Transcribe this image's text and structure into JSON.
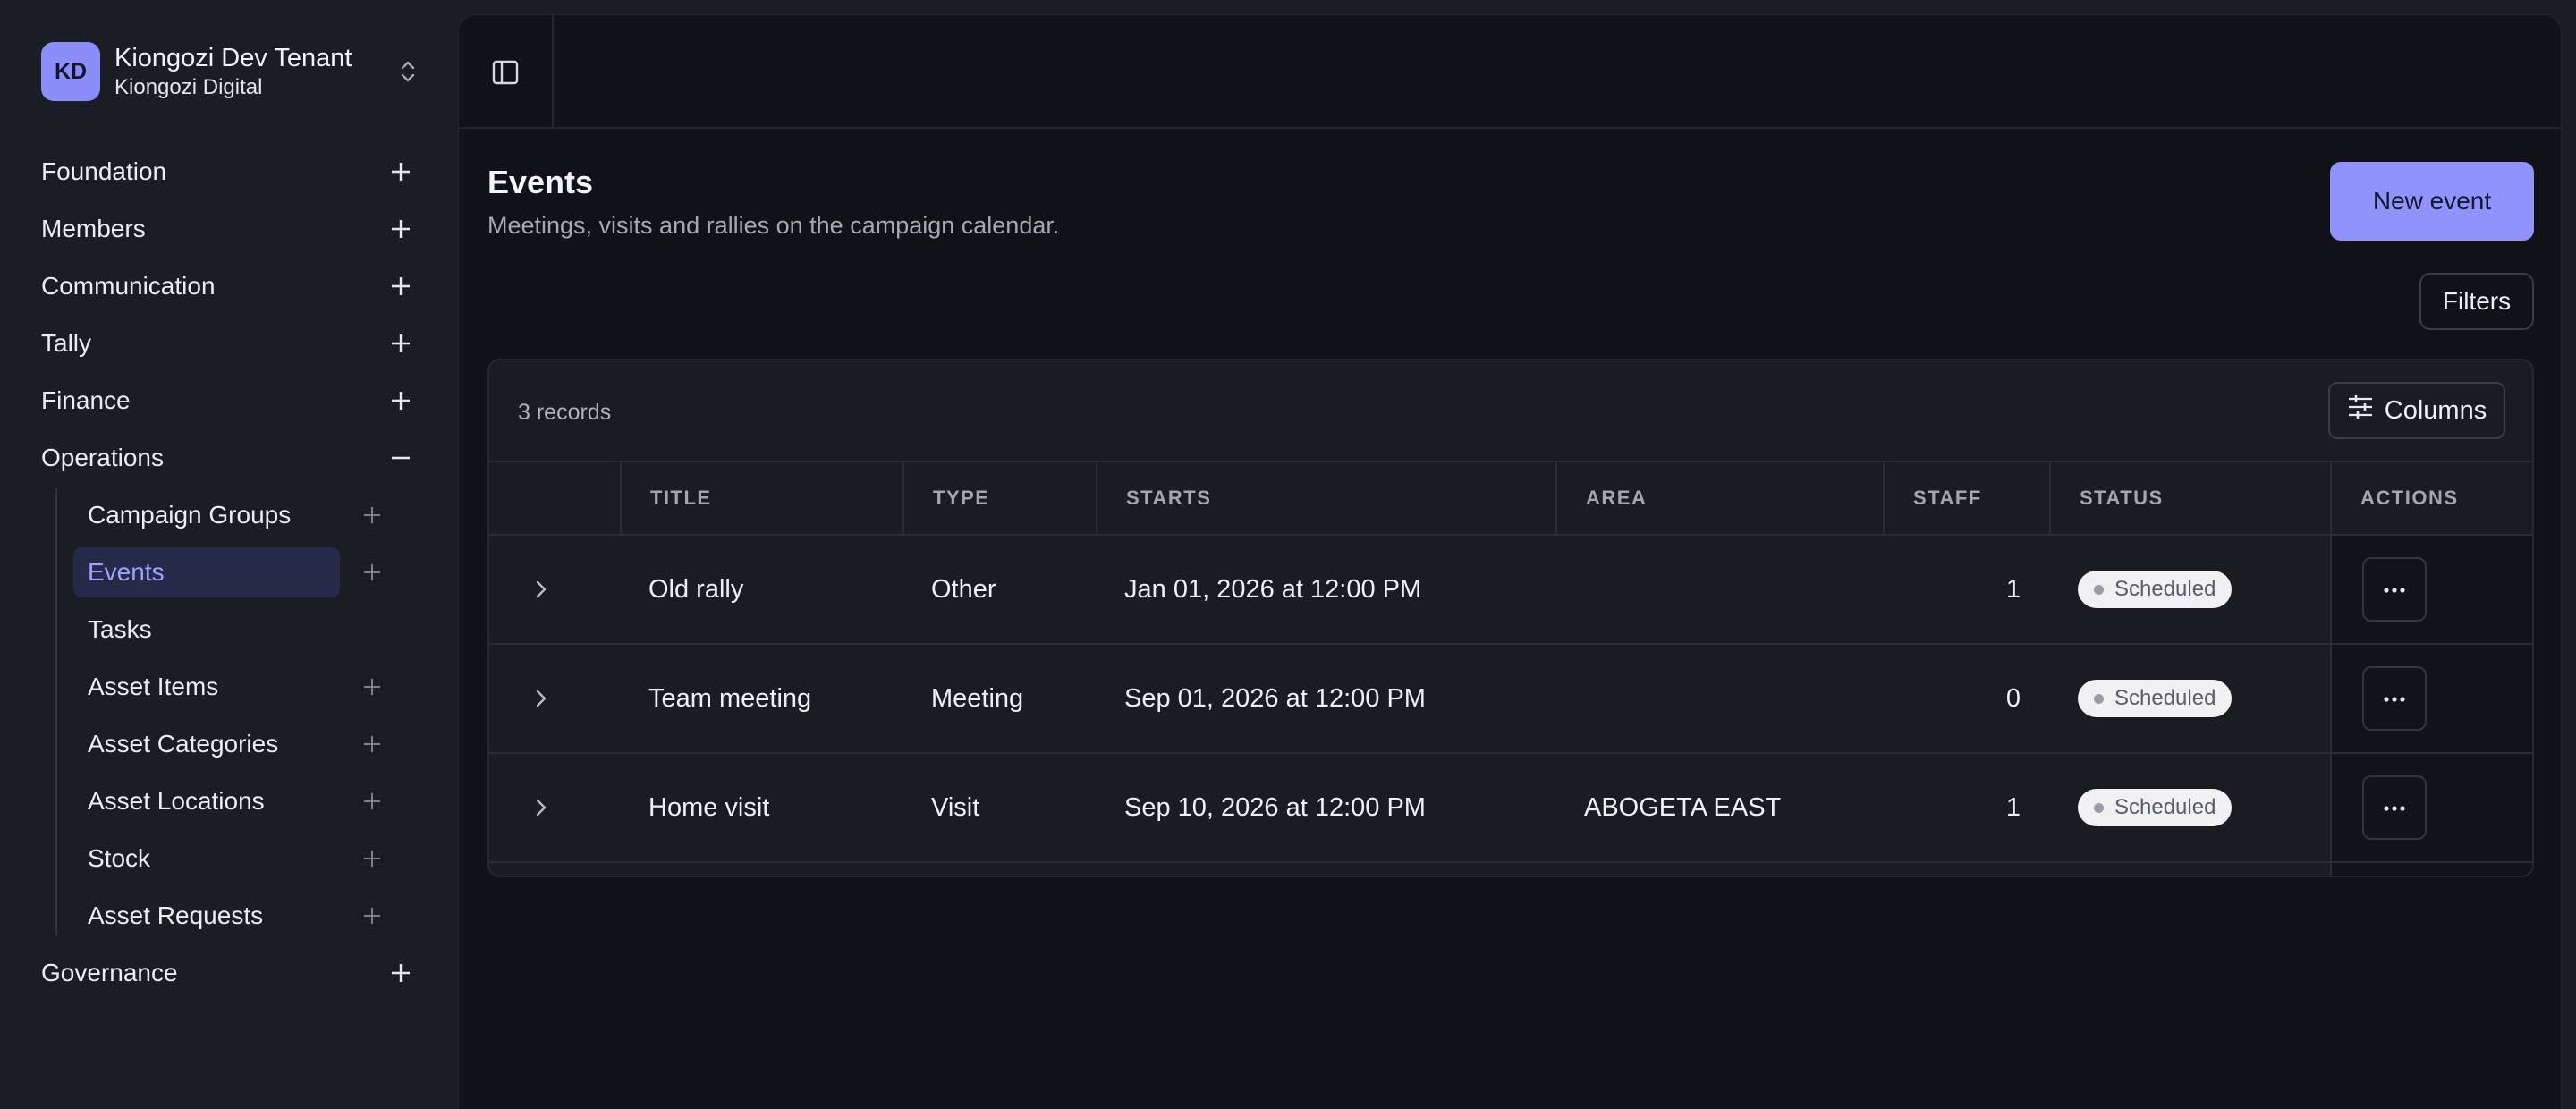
{
  "tenant": {
    "initials": "KD",
    "name": "Kiongozi Dev Tenant",
    "org": "Kiongozi Digital"
  },
  "nav": {
    "items": [
      {
        "label": "Foundation",
        "icon": "plus-icon"
      },
      {
        "label": "Members",
        "icon": "plus-icon"
      },
      {
        "label": "Communication",
        "icon": "plus-icon"
      },
      {
        "label": "Tally",
        "icon": "plus-icon"
      },
      {
        "label": "Finance",
        "icon": "plus-icon"
      },
      {
        "label": "Operations",
        "icon": "minus-icon"
      },
      {
        "label": "Governance",
        "icon": "plus-icon"
      }
    ],
    "operations_children": [
      {
        "label": "Campaign Groups",
        "has_add": true
      },
      {
        "label": "Events",
        "has_add": true,
        "active": true
      },
      {
        "label": "Tasks",
        "has_add": false
      },
      {
        "label": "Asset Items",
        "has_add": true
      },
      {
        "label": "Asset Categories",
        "has_add": true
      },
      {
        "label": "Asset Locations",
        "has_add": true
      },
      {
        "label": "Stock",
        "has_add": true
      },
      {
        "label": "Asset Requests",
        "has_add": true
      }
    ]
  },
  "page": {
    "title": "Events",
    "subtitle": "Meetings, visits and rallies on the campaign calendar.",
    "new_button": "New event",
    "filters_button": "Filters"
  },
  "table": {
    "record_count": "3 records",
    "columns_button": "Columns",
    "headers": [
      "TITLE",
      "TYPE",
      "STARTS",
      "AREA",
      "STAFF",
      "STATUS",
      "ACTIONS"
    ],
    "rows": [
      {
        "title": "Old rally",
        "type": "Other",
        "starts": "Jan 01, 2026 at 12:00 PM",
        "area": "",
        "staff": "1",
        "status": "Scheduled"
      },
      {
        "title": "Team meeting",
        "type": "Meeting",
        "starts": "Sep 01, 2026 at 12:00 PM",
        "area": "",
        "staff": "0",
        "status": "Scheduled"
      },
      {
        "title": "Home visit",
        "type": "Visit",
        "starts": "Sep 10, 2026 at 12:00 PM",
        "area": "ABOGETA EAST",
        "staff": "1",
        "status": "Scheduled"
      }
    ]
  },
  "colors": {
    "accent": "#8f93fb",
    "active_nav_bg": "#252a48",
    "active_nav_text": "#9ea2ff",
    "badge_bg": "#f1f1f3"
  }
}
